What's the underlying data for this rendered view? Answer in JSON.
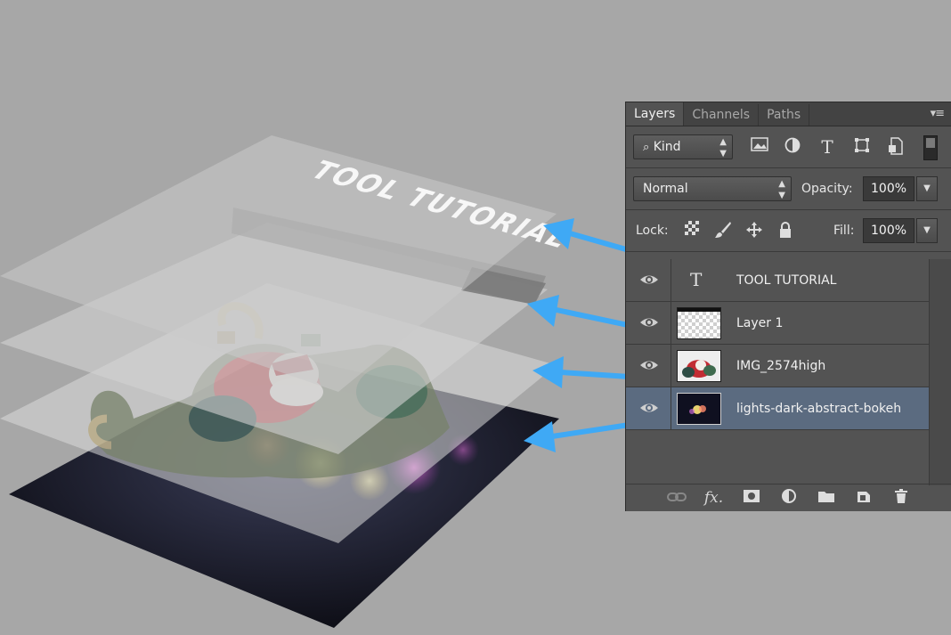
{
  "artwork": {
    "title_text": "TOOL TUTORIAL"
  },
  "panel": {
    "tabs": [
      {
        "label": "Layers",
        "active": true
      },
      {
        "label": "Channels",
        "active": false
      },
      {
        "label": "Paths",
        "active": false
      }
    ],
    "menu_icon": "panel-menu-icon",
    "filter": {
      "label": "Kind",
      "icons": [
        "image-filter-icon",
        "adjustment-filter-icon",
        "type-filter-icon",
        "shape-filter-icon",
        "smart-object-filter-icon"
      ]
    },
    "blend_mode": "Normal",
    "opacity": {
      "label": "Opacity:",
      "value": "100%"
    },
    "lock": {
      "label": "Lock:"
    },
    "fill": {
      "label": "Fill:",
      "value": "100%"
    },
    "layers": [
      {
        "name": "TOOL TUTORIAL",
        "kind": "text",
        "selected": false
      },
      {
        "name": "Layer 1",
        "kind": "transparent",
        "selected": false
      },
      {
        "name": "IMG_2574high",
        "kind": "photo",
        "selected": false
      },
      {
        "name": "lights-dark-abstract-bokeh",
        "kind": "bokeh",
        "selected": true
      }
    ],
    "footer_icons": [
      "link-layers-icon",
      "fx-icon",
      "mask-icon",
      "adjustment-icon",
      "folder-icon",
      "new-layer-icon",
      "trash-icon"
    ],
    "colors": {
      "panel": "#535353",
      "selected_row": "#5b6b80",
      "arrow": "#3fa9f5"
    }
  }
}
